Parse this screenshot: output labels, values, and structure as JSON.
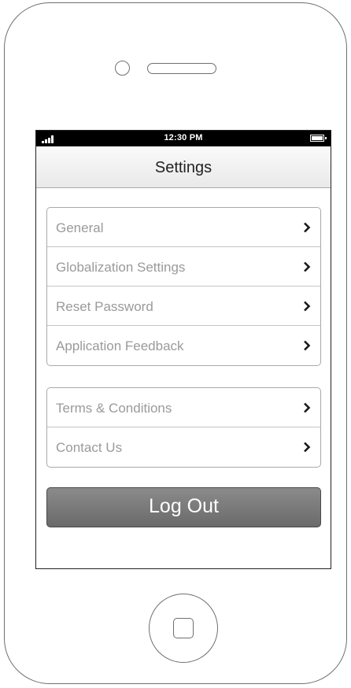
{
  "status_bar": {
    "time": "12:30 PM",
    "signal_icon": "signal-bars-icon",
    "battery_icon": "battery-icon"
  },
  "nav": {
    "title": "Settings"
  },
  "groups": [
    {
      "items": [
        {
          "label": "General",
          "icon": "chevron-right-icon"
        },
        {
          "label": "Globalization Settings",
          "icon": "chevron-right-icon"
        },
        {
          "label": "Reset Password",
          "icon": "chevron-right-icon"
        },
        {
          "label": "Application Feedback",
          "icon": "chevron-right-icon"
        }
      ]
    },
    {
      "items": [
        {
          "label": "Terms & Conditions",
          "icon": "chevron-right-icon"
        },
        {
          "label": "Contact Us",
          "icon": "chevron-right-icon"
        }
      ]
    }
  ],
  "logout": {
    "label": "Log Out",
    "color": "#777777"
  },
  "colors": {
    "label_text": "#9a9a9a",
    "status_bar": "#000000",
    "frame_stroke": "#6f6f6f"
  }
}
